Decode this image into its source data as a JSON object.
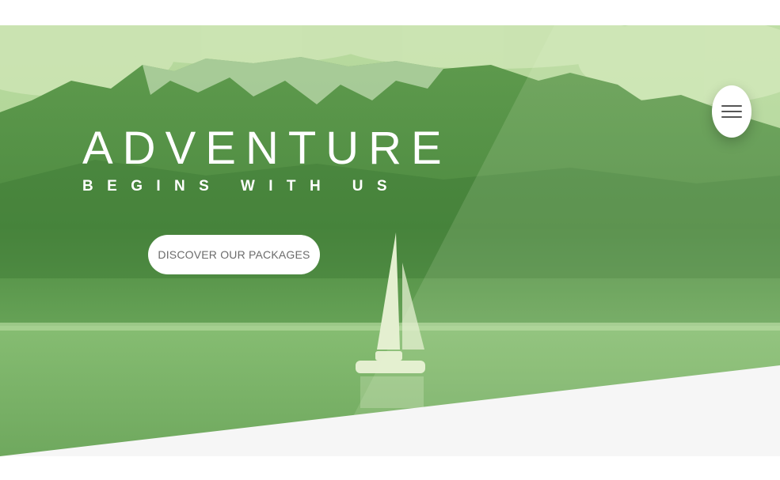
{
  "hero": {
    "title": "ADVENTURE",
    "subtitle": "BEGINS WITH US",
    "cta_label": "DISCOVER OUR PACKAGES"
  },
  "nav": {
    "menu_icon": "hamburger-icon"
  },
  "colors": {
    "overlay_green": "#5f9e4e",
    "button_bg": "#ffffff",
    "button_text": "#6b6b6b",
    "page_bg": "#f6f6f6"
  }
}
